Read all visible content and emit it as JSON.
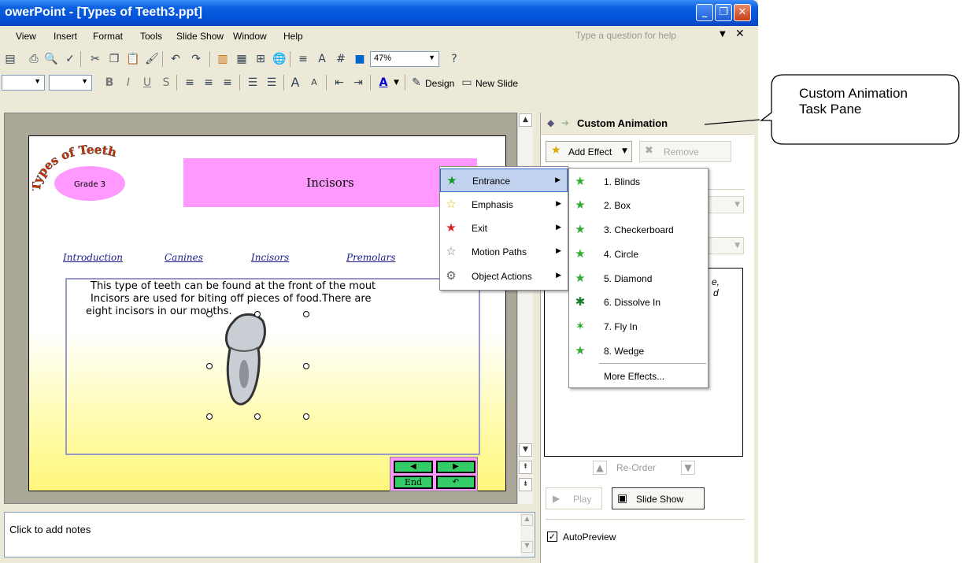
{
  "window": {
    "title": "owerPoint - [Types of Teeth3.ppt]"
  },
  "menubar": {
    "items": [
      "View",
      "Insert",
      "Format",
      "Tools",
      "Slide Show",
      "Window",
      "Help"
    ],
    "help_placeholder": "Type a question for help"
  },
  "toolbar": {
    "zoom": "47%",
    "design_label": "Design",
    "new_slide_label": "New Slide"
  },
  "slide": {
    "logo_text": "Types of Teeth",
    "grade": "Grade 3",
    "title": "Incisors",
    "nav_links": [
      "Introduction",
      "Canines",
      "Incisors",
      "Premolars"
    ],
    "body_text": [
      "This type of teeth can be found at the front of the mout",
      "Incisors are used for biting off pieces of food.There are",
      "eight incisors in our mouths."
    ],
    "end_label": "End"
  },
  "notes": {
    "placeholder": "Click to add notes"
  },
  "task_pane": {
    "title": "Custom Animation",
    "add_effect": "Add Effect",
    "remove": "Remove",
    "reorder": "Re-Order",
    "play": "Play",
    "slide_show": "Slide Show",
    "autopreview": "AutoPreview",
    "autopreview_checked": true,
    "list_partial": [
      "e,",
      "d"
    ]
  },
  "add_effect_menu": {
    "items": [
      "Entrance",
      "Emphasis",
      "Exit",
      "Motion Paths",
      "Object Actions"
    ]
  },
  "entrance_submenu": {
    "items": [
      "1. Blinds",
      "2. Box",
      "3. Checkerboard",
      "4. Circle",
      "5. Diamond",
      "6. Dissolve In",
      "7. Fly In",
      "8. Wedge"
    ],
    "more": "More Effects..."
  },
  "callout": {
    "lines": [
      "Custom Animation",
      "Task Pane"
    ]
  },
  "colors": {
    "title_bar": "#0a5fe0",
    "slide_title_bg": "#ff99ff",
    "menu_highlight": "#c1d2ee",
    "logo_text": "#cc3300",
    "grade_oval": "#ff99ff",
    "nav_button": "#33cc66"
  }
}
